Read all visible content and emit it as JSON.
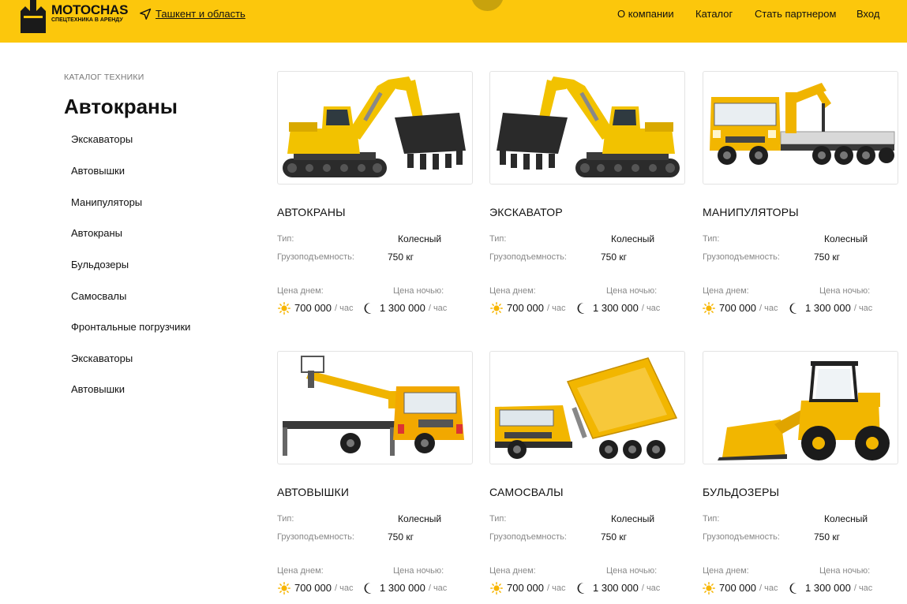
{
  "header": {
    "logo_title": "MOTOCHAS",
    "logo_subtitle": "СПЕЦТЕХНИКА В АРЕНДУ",
    "location": "Ташкент и область",
    "nav": [
      "О компании",
      "Каталог",
      "Стать партнером",
      "Вход"
    ]
  },
  "sidebar": {
    "breadcrumb": "КАТАЛОГ ТЕХНИКИ",
    "title": "Автокраны",
    "items": [
      "Экскаваторы",
      "Автовышки",
      "Манипуляторы",
      "Автокраны",
      "Бульдозеры",
      "Самосвалы",
      "Фронтальные погрузчики",
      "Экскаваторы",
      "Автовышки"
    ]
  },
  "labels": {
    "type": "Тип:",
    "capacity": "Грузоподъемность:",
    "price_day": "Цена днем:",
    "price_night": "Цена ночью:",
    "per_hour": "/ час"
  },
  "cards": [
    {
      "title": "АВТОКРАНЫ",
      "type": "Колесный",
      "capacity": "750 кг",
      "price_day": "700 000",
      "price_night": "1 300 000",
      "image": "excavator-facing-right"
    },
    {
      "title": "ЭКСКАВАТОР",
      "type": "Колесный",
      "capacity": "750 кг",
      "price_day": "700 000",
      "price_night": "1 300 000",
      "image": "excavator-facing-left"
    },
    {
      "title": "МАНИПУЛЯТОРЫ",
      "type": "Колесный",
      "capacity": "750 кг",
      "price_day": "700 000",
      "price_night": "1 300 000",
      "image": "crane-truck"
    },
    {
      "title": "АВТОВЫШКИ",
      "type": "Колесный",
      "capacity": "750 кг",
      "price_day": "700 000",
      "price_night": "1 300 000",
      "image": "aerial-platform-truck"
    },
    {
      "title": "САМОСВАЛЫ",
      "type": "Колесный",
      "capacity": "750 кг",
      "price_day": "700 000",
      "price_night": "1 300 000",
      "image": "dump-truck"
    },
    {
      "title": "БУЛЬДОЗЕРЫ",
      "type": "Колесный",
      "capacity": "750 кг",
      "price_day": "700 000",
      "price_night": "1 300 000",
      "image": "wheel-loader"
    }
  ],
  "colors": {
    "brand_yellow": "#fcc70c",
    "text": "#111111",
    "muted": "#888888",
    "border": "#e3e3e3"
  },
  "icons": {
    "location": "navigation-arrow-icon",
    "day": "sun-icon",
    "night": "moon-icon"
  }
}
